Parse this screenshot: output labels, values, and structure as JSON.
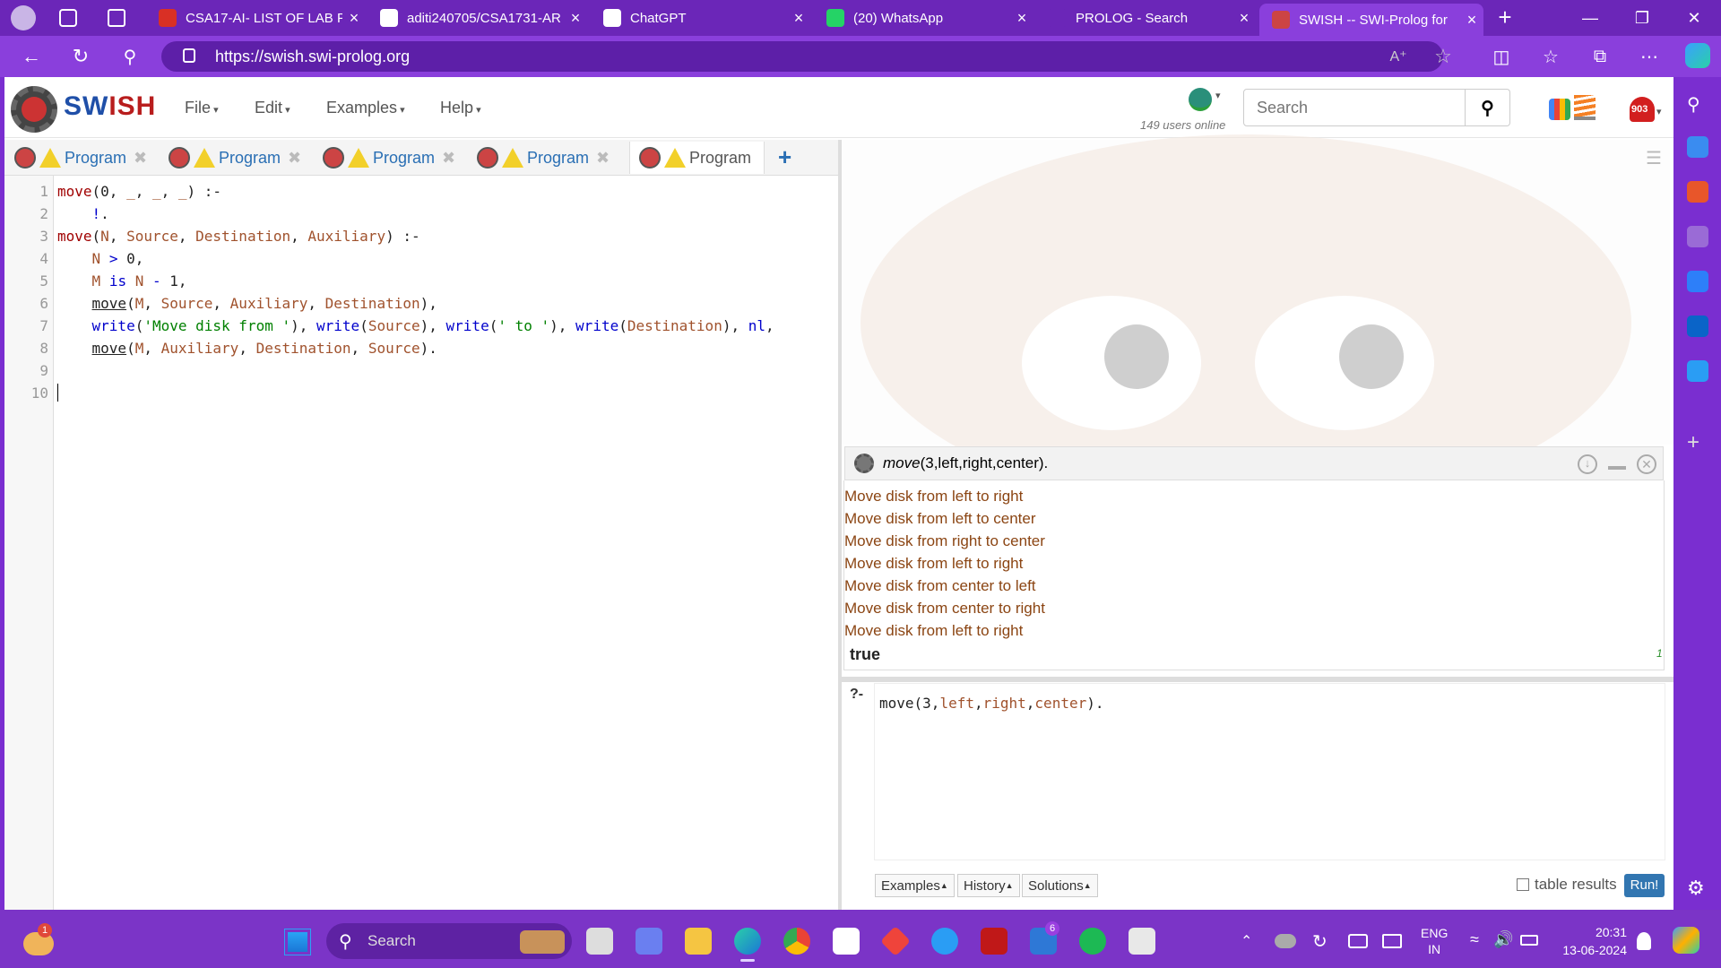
{
  "browser": {
    "tabs": [
      {
        "title": "CSA17-AI- LIST OF LAB PR",
        "icon": "pdf-icon",
        "color": "#d93025"
      },
      {
        "title": "aditi240705/CSA1731-AR",
        "icon": "github-icon",
        "color": "#ffffff"
      },
      {
        "title": "ChatGPT",
        "icon": "chatgpt-icon",
        "color": "#ffffff"
      },
      {
        "title": "(20) WhatsApp",
        "icon": "whatsapp-icon",
        "color": "#25d366"
      },
      {
        "title": "PROLOG - Search",
        "icon": "search-icon",
        "color": "#6b26b8"
      },
      {
        "title": "SWISH -- SWI-Prolog for",
        "icon": "swish-icon",
        "color": "#c44"
      }
    ],
    "url": "https://swish.swi-prolog.org"
  },
  "swish": {
    "logo_text_1": "SW",
    "logo_text_2": "ISH",
    "menu": [
      "File",
      "Edit",
      "Examples",
      "Help"
    ],
    "users_online": "149 users online",
    "search_placeholder": "Search",
    "notif_count": "903",
    "editor_tabs": [
      "Program",
      "Program",
      "Program",
      "Program",
      "Program"
    ],
    "line_numbers": [
      "1",
      "2",
      "3",
      "4",
      "5",
      "6",
      "7",
      "8",
      "9",
      "10"
    ],
    "query_title": "move(3,left,right,center).",
    "query_title_pred": "move",
    "query_title_args": "(3,left,right,center).",
    "output_lines": [
      "Move disk from left to right",
      "Move disk from left to center",
      "Move disk from right to center",
      "Move disk from left to right",
      "Move disk from center to left",
      "Move disk from center to right",
      "Move disk from left to right"
    ],
    "result": "true",
    "result_count": "1",
    "query_prompt": "?-",
    "query_input": "move(3,left,right,center).",
    "query_buttons": [
      "Examples",
      "History",
      "Solutions"
    ],
    "table_results_label": "table results",
    "run_label": "Run!"
  },
  "taskbar": {
    "search_label": "Search",
    "weather_badge": "1",
    "teams_badge": "6",
    "lang_1": "ENG",
    "lang_2": "IN",
    "time": "20:31",
    "date": "13-06-2024"
  }
}
